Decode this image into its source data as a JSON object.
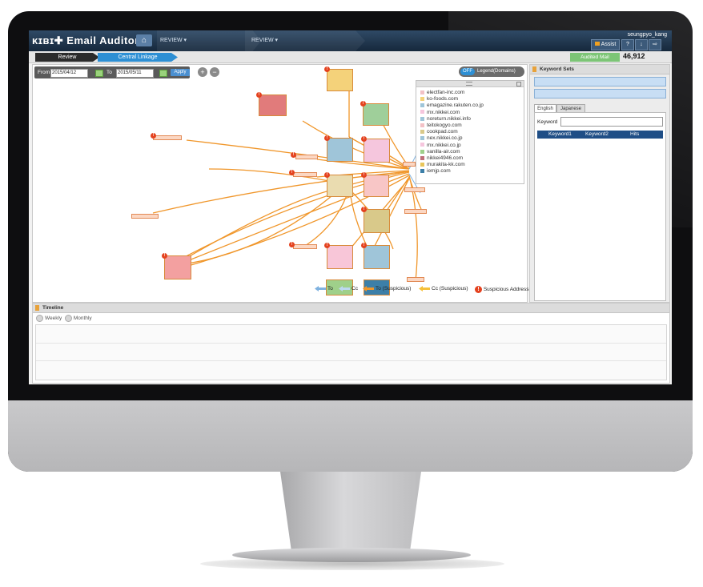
{
  "app": {
    "logo": "ᴋɪʙɪ✚ Email Auditor",
    "user": "seungpyo_kang"
  },
  "topbar": {
    "crumbs": [
      "REVIEW ▾",
      "REVIEW ▾"
    ],
    "buttons": [
      "Assist",
      "?",
      "↓",
      "⇨"
    ]
  },
  "subnav": {
    "review_tab": "Review",
    "central_tab": "Central Linkage",
    "audited_label": "Audited Mail",
    "audited_count": "46,912"
  },
  "date_filter": {
    "from_label": "From",
    "from_value": "2015/04/12",
    "to_label": "To",
    "to_value": "2015/05/11",
    "apply_label": "Apply"
  },
  "legend_toggle": {
    "state": "OFF",
    "title": "Legend(Domains)"
  },
  "domains": [
    {
      "name": "electfan-inc.com",
      "color": "#f2c1c6"
    },
    {
      "name": "ko-foods.com",
      "color": "#f4d27a"
    },
    {
      "name": "emagazine.rakuten.co.jp",
      "color": "#9fc5d9"
    },
    {
      "name": "mx.nikkei.com",
      "color": "#f5c6dd"
    },
    {
      "name": "noreturn.nikkei.info",
      "color": "#9fc5d9"
    },
    {
      "name": "teitokogyo.com",
      "color": "#f2c1c6"
    },
    {
      "name": "cookpad.com",
      "color": "#d9c98a"
    },
    {
      "name": "nex.nikkei.co.jp",
      "color": "#9fc5d9"
    },
    {
      "name": "mx.nikkei.co.jp",
      "color": "#f5c6dd"
    },
    {
      "name": "vanilla-air.com",
      "color": "#9fd08a"
    },
    {
      "name": "nikkei4946.com",
      "color": "#c0707a"
    },
    {
      "name": "murakita-kk.com",
      "color": "#e8c55a"
    },
    {
      "name": "iemjp.com",
      "color": "#3c7fa8"
    }
  ],
  "edge_legend": {
    "to": "To",
    "cc": "Cc",
    "to_suspicious": "To (Suspicious)",
    "cc_suspicious": "Cc (Suspicious)",
    "suspicious_address": "Suspicious Address"
  },
  "keyword_panel": {
    "title": "Keyword Sets",
    "tab_english": "English",
    "tab_japanese": "Japanese",
    "keyword_label": "Keyword",
    "columns": [
      "Keyword1",
      "Keyword2",
      "Hits"
    ]
  },
  "timeline": {
    "title": "Timeline",
    "weekly": "Weekly",
    "monthly": "Monthly"
  },
  "colors": {
    "edge": "#f0962a",
    "edge_blue": "#7fb2e0",
    "accent": "#2d8fd4",
    "topbar": "#1e3550"
  }
}
